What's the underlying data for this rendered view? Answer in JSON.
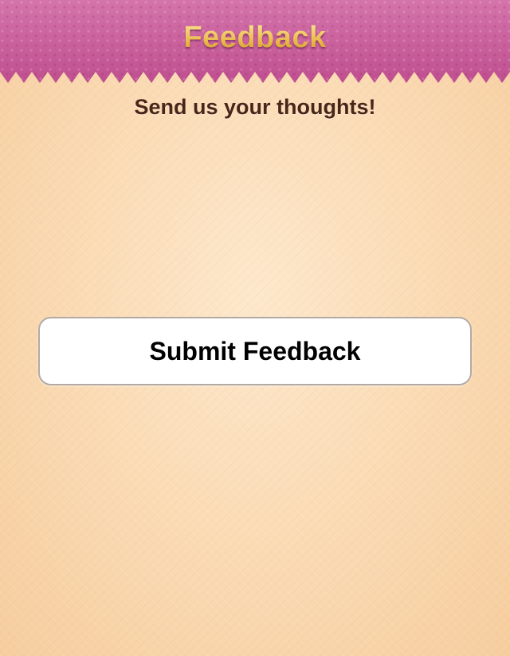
{
  "header": {
    "title": "Feedback"
  },
  "main": {
    "subtitle": "Send us your thoughts!",
    "submit_label": "Submit Feedback"
  },
  "colors": {
    "header_pink": "#c95f9c",
    "title_gold": "#f3cf6b",
    "background_peach": "#fbdcb6",
    "subtitle_brown": "#4a2618",
    "button_white": "#ffffff",
    "button_border": "#b3aaa4"
  }
}
